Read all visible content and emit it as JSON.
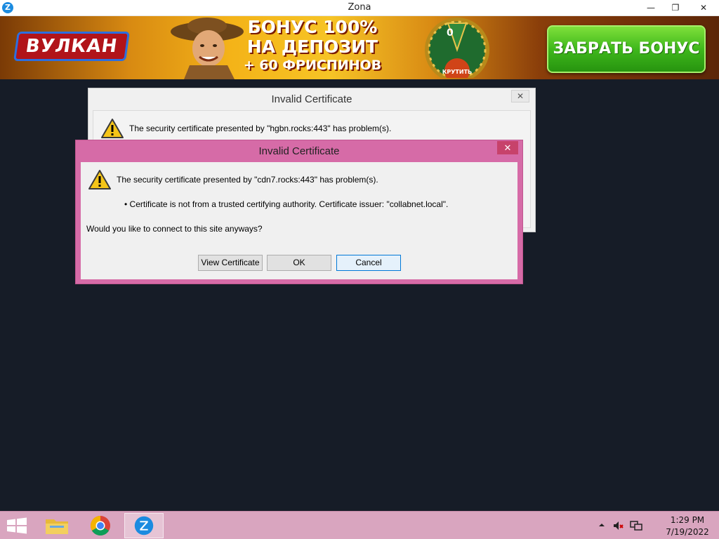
{
  "app": {
    "title": "Zona",
    "icon_glyph": "Z"
  },
  "window_controls": {
    "minimize": "—",
    "restore": "❐",
    "close": "✕"
  },
  "banner": {
    "logo_text": "ВУЛКАН",
    "offer_line1": "БОНУС 100%",
    "offer_line2": "НА ДЕПОЗИТ",
    "offer_line3": "+ 60 ФРИСПИНОВ",
    "wheel_label": "0",
    "spin_label": "КРУТИТЬ",
    "cta_label": "ЗАБРАТЬ БОНУС"
  },
  "dialog_back": {
    "title": "Invalid Certificate",
    "close_glyph": "✕",
    "message": "The security certificate presented by \"hgbn.rocks:443\" has problem(s)."
  },
  "dialog_front": {
    "title": "Invalid Certificate",
    "close_glyph": "✕",
    "message": "The security certificate presented by \"cdn7.rocks:443\" has problem(s).",
    "bullet": "•  Certificate is not from a trusted certifying authority.  Certificate issuer: \"collabnet.local\".",
    "question": "Would you like to connect to this site anyways?",
    "buttons": {
      "view_certificate": "View Certificate",
      "ok": "OK",
      "cancel": "Cancel"
    }
  },
  "taskbar": {
    "items": [
      "file-explorer",
      "chrome",
      "zona"
    ],
    "clock_time": "1:29 PM",
    "clock_date": "7/19/2022"
  },
  "colors": {
    "accent_dialog": "#d66ba7",
    "taskbar": "#d9a5bf",
    "desktop": "#161c27",
    "cta": "#3fb81c"
  }
}
